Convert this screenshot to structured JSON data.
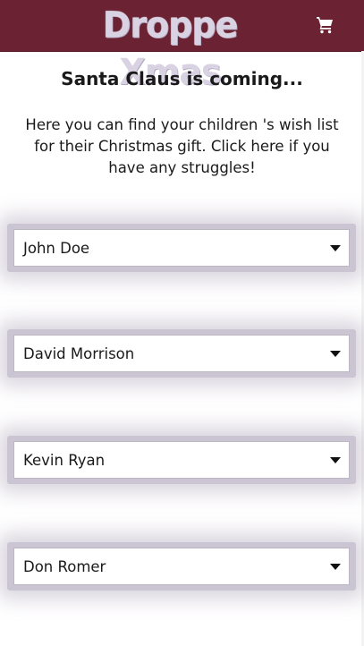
{
  "header": {
    "brand": "Droppe Xmas",
    "cart_icon": "shopping-cart-icon",
    "background_color": "#6b2233"
  },
  "main": {
    "title": "Santa Claus is coming...",
    "intro": "Here you can find your children 's wish list for their Christmas gift. Click here if you have any struggles!"
  },
  "children": [
    {
      "name": "John Doe",
      "icon": "chevron-down-icon"
    },
    {
      "name": "David Morrison",
      "icon": "chevron-down-icon"
    },
    {
      "name": "Kevin Ryan",
      "icon": "chevron-down-icon"
    },
    {
      "name": "Don Romer",
      "icon": "chevron-down-icon"
    }
  ]
}
